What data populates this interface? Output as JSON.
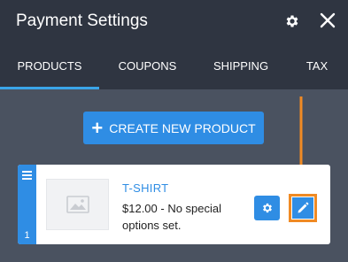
{
  "header": {
    "title": "Payment Settings",
    "icons": {
      "settings": "gear-icon",
      "close": "close-icon"
    }
  },
  "tabs": [
    {
      "label": "PRODUCTS",
      "active": true
    },
    {
      "label": "COUPONS",
      "active": false
    },
    {
      "label": "SHIPPING",
      "active": false
    },
    {
      "label": "TAX",
      "active": false
    }
  ],
  "create_button": {
    "label": "CREATE NEW PRODUCT",
    "icon": "plus-icon"
  },
  "product": {
    "index": "1",
    "name": "T-SHIRT",
    "description": "$12.00 - No special options set.",
    "thumbnail_icon": "image-placeholder-icon",
    "actions": {
      "settings_icon": "gear-icon",
      "edit_icon": "pencil-icon"
    }
  },
  "colors": {
    "header_bg": "#2f3541",
    "panel_bg": "#4a5260",
    "accent": "#2f8de4",
    "active_tab_underline": "#3aa5e8",
    "highlight": "#f08a24"
  }
}
